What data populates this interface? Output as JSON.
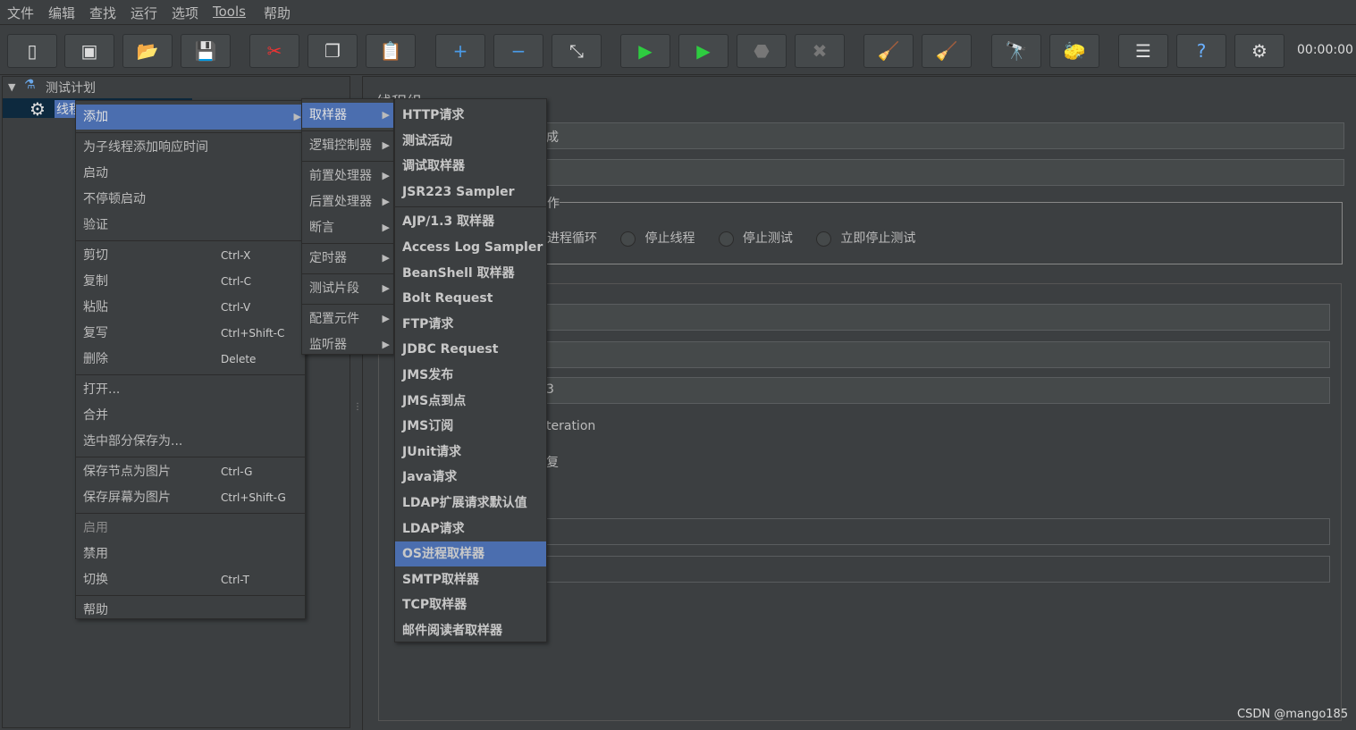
{
  "menubar": [
    "文件",
    "编辑",
    "查找",
    "运行",
    "选项",
    "Tools",
    "帮助"
  ],
  "toolbar": {
    "buttons": [
      "new-icon",
      "templates-icon",
      "open-icon",
      "save-icon",
      "cut-icon",
      "copy-icon",
      "paste-icon",
      "expand-icon",
      "collapse-icon",
      "toggle-icon",
      "start-icon",
      "start-no-pauses-icon",
      "stop-icon",
      "shutdown-icon",
      "clear-icon",
      "clear-all-icon",
      "search-icon",
      "reset-search-icon",
      "function-helper-icon",
      "help-icon",
      "remote-icon"
    ],
    "timer": "00:00:00"
  },
  "tree": {
    "root": "测试计划",
    "child": "线程组"
  },
  "context_menu": {
    "items": [
      {
        "label": "添加",
        "submenu": true,
        "highlight": true
      },
      {
        "sep": true
      },
      {
        "label": "为子线程添加响应时间"
      },
      {
        "label": "启动"
      },
      {
        "label": "不停顿启动"
      },
      {
        "label": "验证"
      },
      {
        "sep": true
      },
      {
        "label": "剪切",
        "shortcut": "Ctrl-X"
      },
      {
        "label": "复制",
        "shortcut": "Ctrl-C"
      },
      {
        "label": "粘贴",
        "shortcut": "Ctrl-V"
      },
      {
        "label": "复写",
        "shortcut": "Ctrl+Shift-C"
      },
      {
        "label": "删除",
        "shortcut": "Delete"
      },
      {
        "sep": true
      },
      {
        "label": "打开..."
      },
      {
        "label": "合并"
      },
      {
        "label": "选中部分保存为..."
      },
      {
        "sep": true
      },
      {
        "label": "保存节点为图片",
        "shortcut": "Ctrl-G"
      },
      {
        "label": "保存屏幕为图片",
        "shortcut": "Ctrl+Shift-G"
      },
      {
        "sep": true
      },
      {
        "label": "启用",
        "disabled": true
      },
      {
        "label": "禁用"
      },
      {
        "label": "切换",
        "shortcut": "Ctrl-T"
      },
      {
        "sep": true
      },
      {
        "label": "帮助"
      }
    ]
  },
  "add_submenu": {
    "items": [
      {
        "label": "取样器",
        "highlight": true
      },
      {
        "sep": true
      },
      {
        "label": "逻辑控制器"
      },
      {
        "sep": true
      },
      {
        "label": "前置处理器"
      },
      {
        "label": "后置处理器"
      },
      {
        "label": "断言"
      },
      {
        "sep": true
      },
      {
        "label": "定时器"
      },
      {
        "sep": true
      },
      {
        "label": "测试片段"
      },
      {
        "sep": true
      },
      {
        "label": "配置元件"
      },
      {
        "label": "监听器"
      }
    ]
  },
  "sampler_submenu": {
    "items": [
      {
        "label": "HTTP请求"
      },
      {
        "label": "测试活动"
      },
      {
        "label": "调试取样器"
      },
      {
        "label": "JSR223 Sampler"
      },
      {
        "sep": true
      },
      {
        "label": "AJP/1.3 取样器"
      },
      {
        "label": "Access Log Sampler"
      },
      {
        "label": "BeanShell 取样器"
      },
      {
        "label": "Bolt Request"
      },
      {
        "label": "FTP请求"
      },
      {
        "label": "JDBC Request"
      },
      {
        "label": "JMS发布"
      },
      {
        "label": "JMS点到点"
      },
      {
        "label": "JMS订阅"
      },
      {
        "label": "JUnit请求"
      },
      {
        "label": "Java请求"
      },
      {
        "label": "LDAP扩展请求默认值"
      },
      {
        "label": "LDAP请求"
      },
      {
        "label": "OS进程取样器",
        "highlight": true
      },
      {
        "label": "SMTP取样器"
      },
      {
        "label": "TCP取样器"
      },
      {
        "label": "邮件阅读者取样器"
      }
    ]
  },
  "right": {
    "title": "线程组",
    "name_fragment": "成",
    "action_fragment": "作",
    "radios": [
      "进程循环",
      "停止线程",
      "停止测试",
      "立即停止测试"
    ],
    "field_fragment": "3",
    "iteration_fragment": "teration",
    "delay_fragment": "复"
  },
  "watermark": "CSDN @mango185",
  "colors": {
    "highlight": "#4b6eaf",
    "background": "#3c3f41"
  }
}
